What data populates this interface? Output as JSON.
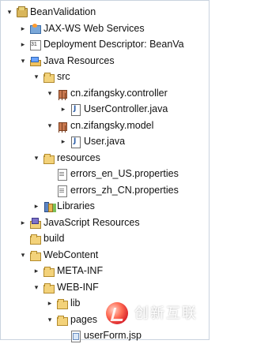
{
  "tree": [
    {
      "indent": 0,
      "toggle": "▾",
      "icon": "project-folder-icon",
      "label": "BeanValidation"
    },
    {
      "indent": 1,
      "toggle": "▸",
      "icon": "web-services-icon",
      "label": "JAX-WS Web Services"
    },
    {
      "indent": 1,
      "toggle": "▸",
      "icon": "deployment-descriptor-icon",
      "label": "Deployment Descriptor: BeanVa"
    },
    {
      "indent": 1,
      "toggle": "▾",
      "icon": "java-resources-icon",
      "label": "Java Resources"
    },
    {
      "indent": 2,
      "toggle": "▾",
      "icon": "source-folder-icon",
      "label": "src"
    },
    {
      "indent": 3,
      "toggle": "▾",
      "icon": "package-icon",
      "label": "cn.zifangsky.controller"
    },
    {
      "indent": 4,
      "toggle": "▸",
      "icon": "java-file-icon",
      "label": "UserController.java"
    },
    {
      "indent": 3,
      "toggle": "▾",
      "icon": "package-icon",
      "label": "cn.zifangsky.model"
    },
    {
      "indent": 4,
      "toggle": "▸",
      "icon": "java-file-icon",
      "label": "User.java"
    },
    {
      "indent": 2,
      "toggle": "▾",
      "icon": "folder-icon",
      "label": "resources"
    },
    {
      "indent": 3,
      "toggle": "",
      "icon": "properties-file-icon",
      "label": "errors_en_US.properties"
    },
    {
      "indent": 3,
      "toggle": "",
      "icon": "properties-file-icon",
      "label": "errors_zh_CN.properties"
    },
    {
      "indent": 2,
      "toggle": "▸",
      "icon": "libraries-icon",
      "label": "Libraries"
    },
    {
      "indent": 1,
      "toggle": "▸",
      "icon": "javascript-resources-icon",
      "label": "JavaScript Resources"
    },
    {
      "indent": 1,
      "toggle": "",
      "icon": "folder-icon",
      "label": "build"
    },
    {
      "indent": 1,
      "toggle": "▾",
      "icon": "folder-icon",
      "label": "WebContent"
    },
    {
      "indent": 2,
      "toggle": "▸",
      "icon": "folder-icon",
      "label": "META-INF"
    },
    {
      "indent": 2,
      "toggle": "▾",
      "icon": "folder-icon",
      "label": "WEB-INF"
    },
    {
      "indent": 3,
      "toggle": "▸",
      "icon": "folder-icon",
      "label": "lib"
    },
    {
      "indent": 3,
      "toggle": "▾",
      "icon": "folder-icon",
      "label": "pages"
    },
    {
      "indent": 4,
      "toggle": "",
      "icon": "jsp-file-icon",
      "label": "userForm.jsp"
    }
  ],
  "watermark": {
    "text": "创新互联"
  }
}
